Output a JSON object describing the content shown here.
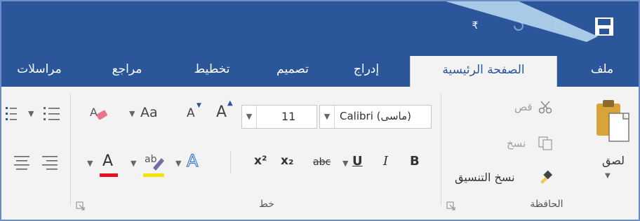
{
  "window": {
    "accent_color": "#2b579a",
    "qat": {
      "save_icon": "save-icon",
      "undo_icon": "undo-icon",
      "redo_icon": "redo-icon",
      "customize_label": "₹"
    }
  },
  "tabs": [
    {
      "label": "ملف",
      "active": false
    },
    {
      "label": "الصفحة الرئيسية",
      "active": true
    },
    {
      "label": "إدراج",
      "active": false
    },
    {
      "label": "تصميم",
      "active": false
    },
    {
      "label": "تخطيط",
      "active": false
    },
    {
      "label": "مراجع",
      "active": false
    },
    {
      "label": "مراسلات",
      "active": false
    }
  ],
  "clipboard": {
    "group_label": "الحافظة",
    "paste_label": "لصق",
    "cut_label": "قص",
    "copy_label": "نسخ",
    "format_painter_label": "نسخ التنسيق"
  },
  "font": {
    "group_label": "خط",
    "font_name": "Calibri (ماسی)",
    "font_size": "11",
    "grow_font_label": "A",
    "shrink_font_label": "A",
    "change_case_label": "Aa",
    "bold_label": "B",
    "italic_label": "I",
    "underline_label": "U",
    "strike_label": "abc",
    "subscript_label": "x₂",
    "superscript_label": "x²",
    "font_color_label": "A",
    "highlight_label": "ab",
    "text_effects_label": "A",
    "font_color": "#e81123",
    "highlight_color": "#f4e300"
  }
}
